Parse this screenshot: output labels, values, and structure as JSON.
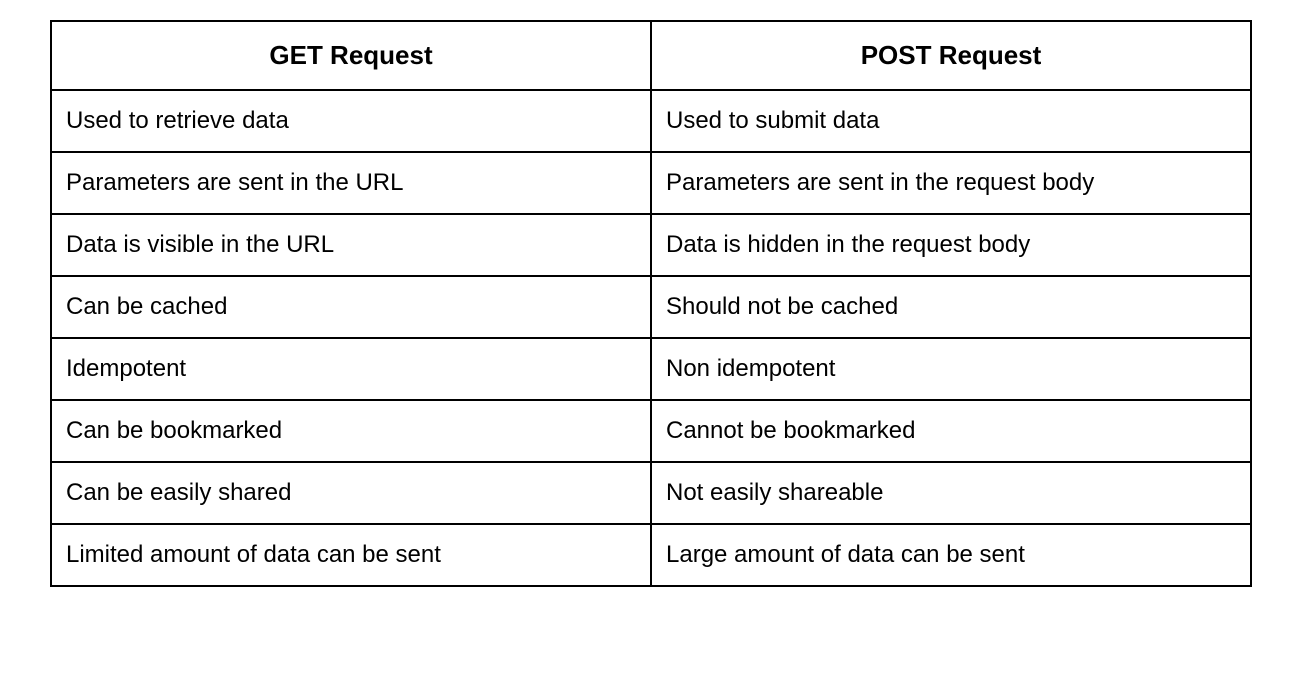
{
  "table": {
    "headers": [
      "GET Request",
      "POST Request"
    ],
    "rows": [
      {
        "get": "Used to retrieve data",
        "post": "Used to submit data"
      },
      {
        "get": "Parameters are sent in the URL",
        "post": "Parameters are sent in the request body"
      },
      {
        "get": "Data is visible in the URL",
        "post": "Data is hidden in the request body"
      },
      {
        "get": "Can be cached",
        "post": "Should not be cached"
      },
      {
        "get": "Idempotent",
        "post": "Non idempotent"
      },
      {
        "get": "Can be bookmarked",
        "post": "Cannot be bookmarked"
      },
      {
        "get": "Can be easily shared",
        "post": "Not easily shareable"
      },
      {
        "get": "Limited amount of data can be sent",
        "post": "Large amount of data can be sent"
      }
    ]
  }
}
